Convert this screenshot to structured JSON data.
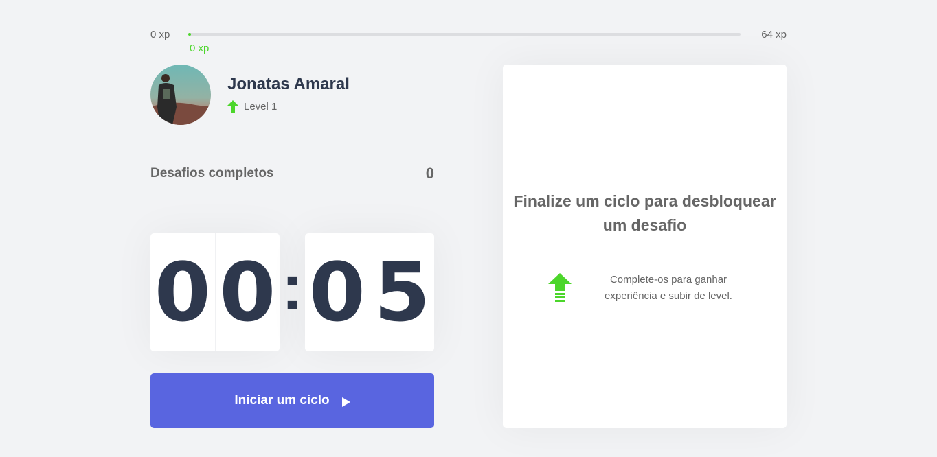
{
  "experience": {
    "min_label": "0 xp",
    "max_label": "64 xp",
    "current_label": "0 xp",
    "progress_fraction": 0
  },
  "profile": {
    "name": "Jonatas Amaral",
    "level_label": "Level 1",
    "level_icon": "level-up-arrow-icon"
  },
  "completed_challenges": {
    "label": "Desafios completos",
    "value": "0"
  },
  "countdown": {
    "minute_left": "0",
    "minute_right": "0",
    "separator": ":",
    "second_left": "0",
    "second_right": "5"
  },
  "start_button": {
    "label": "Iniciar um ciclo",
    "icon": "play-icon"
  },
  "challenge_box": {
    "title": "Finalize um ciclo para desbloquear um desafio",
    "hint": "Complete-os para ganhar experiência e subir de level.",
    "hint_icon": "level-up-icon"
  },
  "colors": {
    "background": "#f2f3f5",
    "accent_green": "#4cd62b",
    "primary_button": "#5965e0",
    "title_dark": "#2e384d",
    "text_gray": "#666666"
  }
}
